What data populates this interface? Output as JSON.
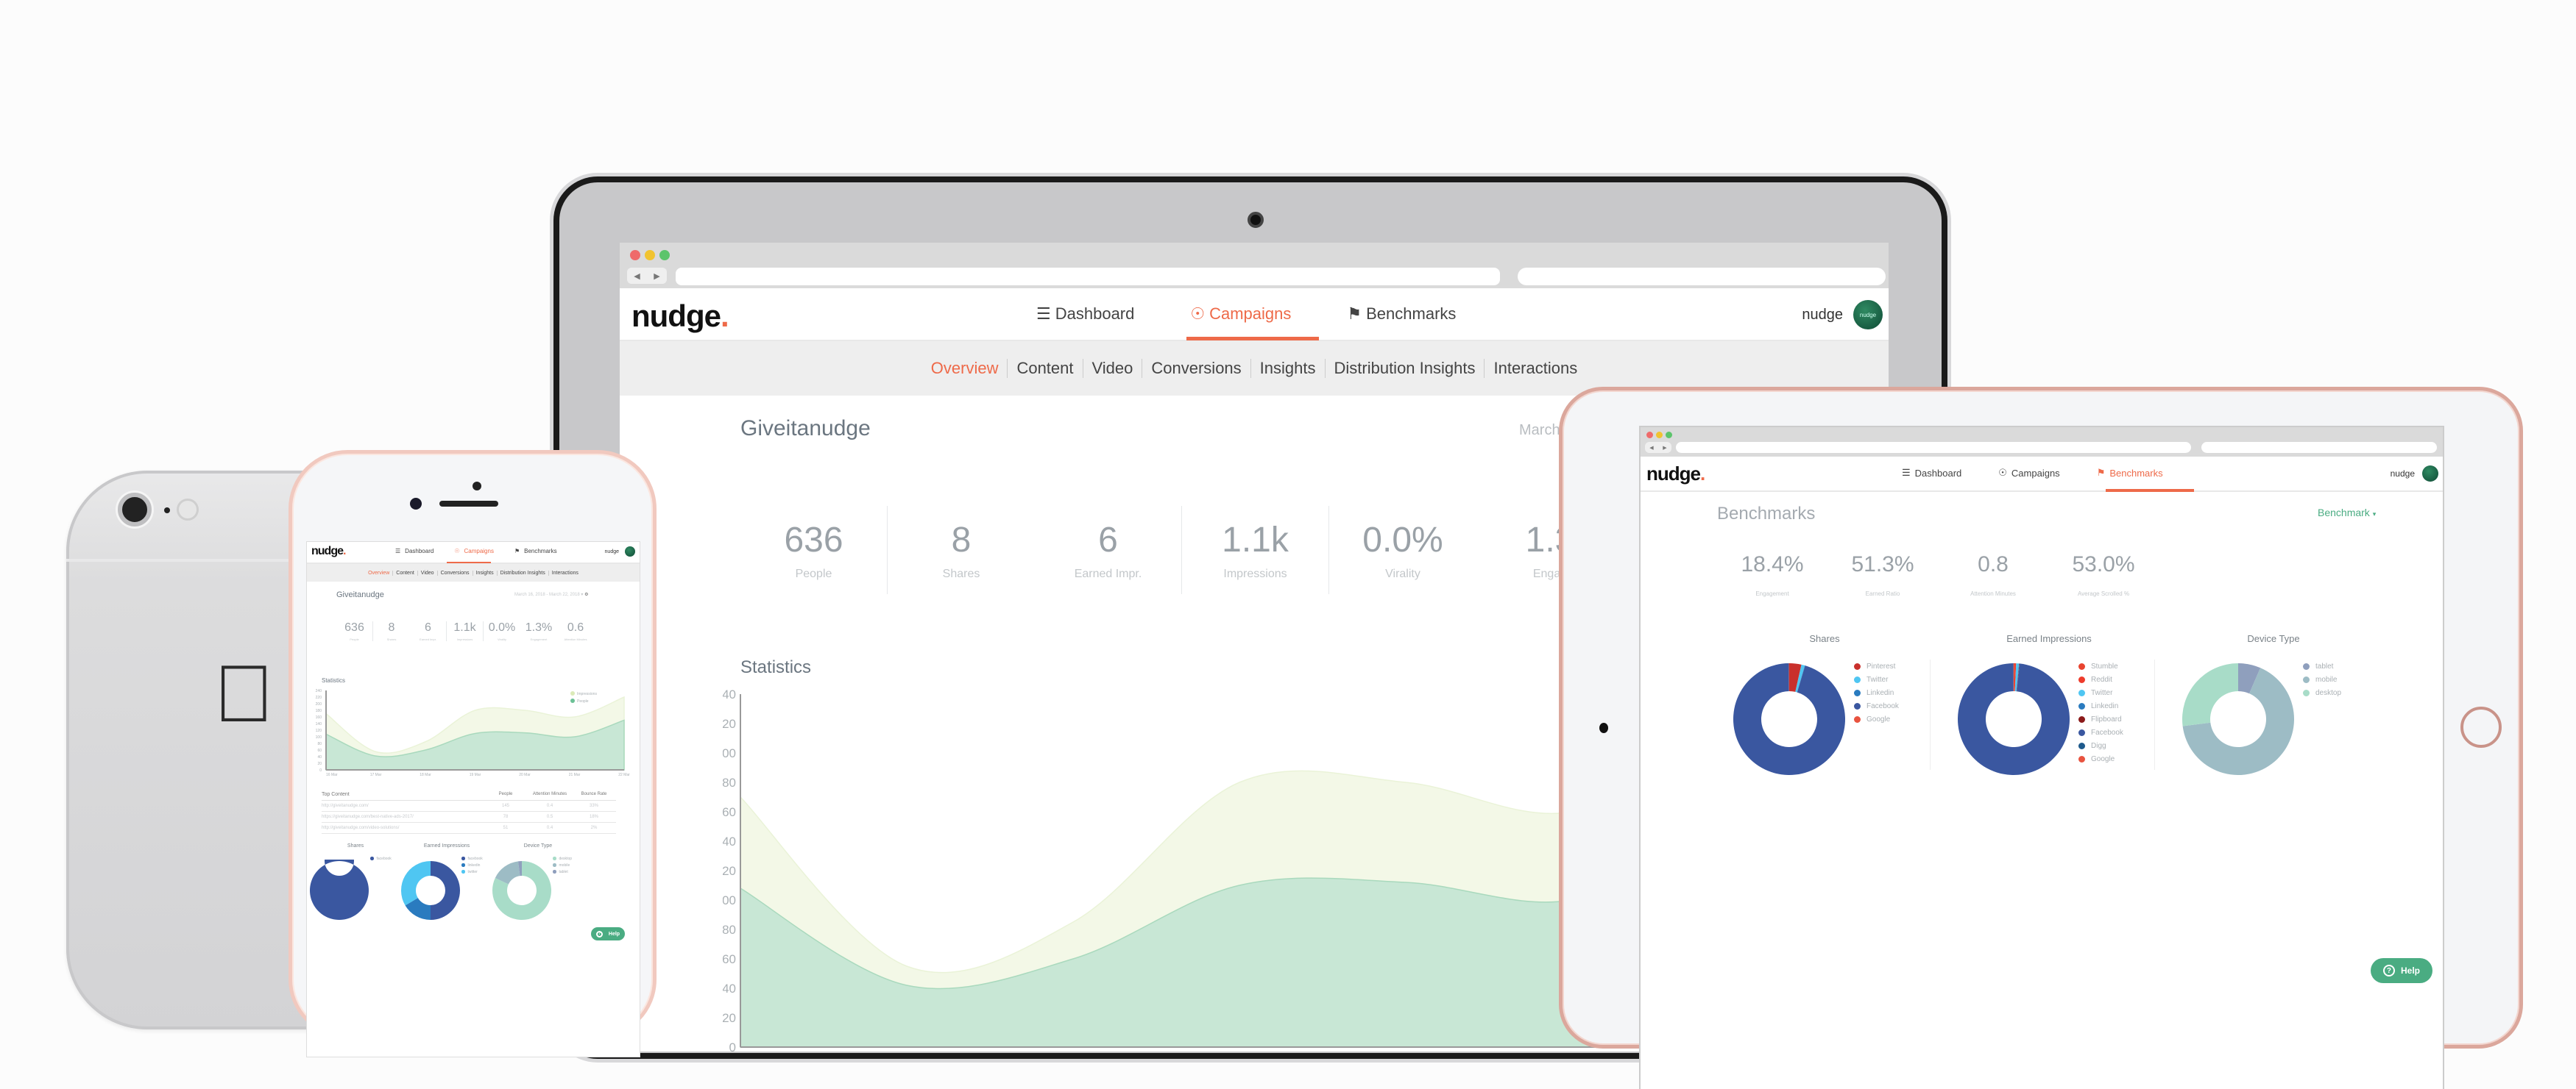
{
  "app": {
    "logo": "nudge",
    "logo_period": ".",
    "user_name": "nudge",
    "avatar_text": "nudge",
    "accent_color": "#ee6a49",
    "help_color": "#4aac82"
  },
  "topnav": [
    {
      "label": "Dashboard",
      "icon": "layers-icon"
    },
    {
      "label": "Campaigns",
      "icon": "compass-icon"
    },
    {
      "label": "Benchmarks",
      "icon": "flag-icon"
    }
  ],
  "subnav": [
    "Overview",
    "Content",
    "Video",
    "Conversions",
    "Insights",
    "Distribution Insights",
    "Interactions"
  ],
  "campaign": {
    "title": "Giveitanudge",
    "date_range": "March 16, 2018 - March 22, 2018",
    "date_range_truncated": "March",
    "stats": [
      {
        "value": "636",
        "label": "People"
      },
      {
        "value": "8",
        "label": "Shares"
      },
      {
        "value": "6",
        "label": "Earned Impr."
      },
      {
        "value": "1.1k",
        "label": "Impressions"
      },
      {
        "value": "0.0%",
        "label": "Virality"
      },
      {
        "value": "1.3%",
        "label": "Engagement"
      },
      {
        "value": "0.6",
        "label": "Attention Minutes"
      }
    ],
    "stats_truncated_label": "Engag",
    "stats_truncated_value": "1.3",
    "statistics_title": "Statistics",
    "top_content": {
      "title": "Top Content",
      "columns": [
        "People",
        "Attention Minutes",
        "Bounce Rate"
      ],
      "rows": [
        {
          "url": "http://giveitanudge.com/",
          "people": "145",
          "attention": "0.4",
          "bounce": "33%"
        },
        {
          "url": "https://giveitanudge.com/best-native-ads-2017/",
          "people": "78",
          "attention": "0.5",
          "bounce": "18%"
        },
        {
          "url": "http://giveitanudge.com/video-solutions/",
          "people": "51",
          "attention": "0.4",
          "bounce": "2%"
        }
      ]
    },
    "help_label": "Help"
  },
  "benchmarks": {
    "title": "Benchmarks",
    "dropdown_label": "Benchmark",
    "stats": [
      {
        "value": "18.4%",
        "label": "Engagement"
      },
      {
        "value": "51.3%",
        "label": "Earned Ratio"
      },
      {
        "value": "0.8",
        "label": "Attention Minutes"
      },
      {
        "value": "53.0%",
        "label": "Average Scrolled %"
      }
    ],
    "help_label": "Help"
  },
  "chart_data": [
    {
      "type": "area",
      "title": "Statistics",
      "x": [
        "16 Mar",
        "17 Mar",
        "18 Mar",
        "19 Mar",
        "20 Mar",
        "21 Mar",
        "22 Mar"
      ],
      "series": [
        {
          "name": "Impressions",
          "values": [
            170,
            55,
            85,
            180,
            180,
            160,
            220
          ],
          "color": "#f3f8e7"
        },
        {
          "name": "People",
          "values": [
            108,
            42,
            60,
            110,
            112,
            100,
            150
          ],
          "color": "#c8e7d5"
        }
      ],
      "yticks": [
        0,
        20,
        40,
        60,
        80,
        100,
        120,
        140,
        160,
        180,
        200,
        220,
        240
      ],
      "ylim": [
        0,
        240
      ],
      "legend": "top-right"
    },
    {
      "type": "pie",
      "title": "Shares",
      "context": "benchmarks",
      "labels": [
        "Pinterest",
        "Twitter",
        "Linkedin",
        "Facebook",
        "Google"
      ],
      "values": [
        3.5,
        1.0,
        0.1,
        95.3,
        0.1
      ],
      "colors": [
        "#c9302c",
        "#4fc6f2",
        "#2a7bbf",
        "#3a57a0",
        "#e8533f"
      ]
    },
    {
      "type": "pie",
      "title": "Earned Impressions",
      "context": "benchmarks",
      "labels": [
        "Stumble",
        "Reddit",
        "Twitter",
        "Linkedin",
        "Flipboard",
        "Facebook",
        "Digg",
        "Google"
      ],
      "values": [
        0.3,
        0.4,
        0.8,
        0.1,
        0.1,
        98.2,
        0.05,
        0.05
      ],
      "colors": [
        "#e8442f",
        "#ee3b2b",
        "#4fc6f2",
        "#2a7bbf",
        "#8b1a1a",
        "#3a57a0",
        "#1e5a8c",
        "#e8533f"
      ]
    },
    {
      "type": "pie",
      "title": "Device Type",
      "context": "benchmarks",
      "labels": [
        "tablet",
        "mobile",
        "desktop"
      ],
      "values": [
        6.5,
        66.5,
        27.0
      ],
      "colors": [
        "#8f9fbd",
        "#9dbcc5",
        "#a8dcc8"
      ]
    },
    {
      "type": "pie",
      "title": "Shares",
      "context": "campaign",
      "labels": [
        "facebook"
      ],
      "values": [
        100
      ],
      "colors": [
        "#3a57a0"
      ]
    },
    {
      "type": "pie",
      "title": "Earned Impressions",
      "context": "campaign",
      "labels": [
        "facebook",
        "linkedin",
        "twitter"
      ],
      "values": [
        50,
        16.5,
        33.5
      ],
      "colors": [
        "#3a57a0",
        "#2a7bbf",
        "#4fc6f2"
      ]
    },
    {
      "type": "pie",
      "title": "Device Type",
      "context": "campaign",
      "labels": [
        "desktop",
        "mobile",
        "tablet"
      ],
      "values": [
        82,
        16,
        2
      ],
      "colors": [
        "#a8dcc8",
        "#9dbcc5",
        "#8f9fbd"
      ]
    }
  ]
}
